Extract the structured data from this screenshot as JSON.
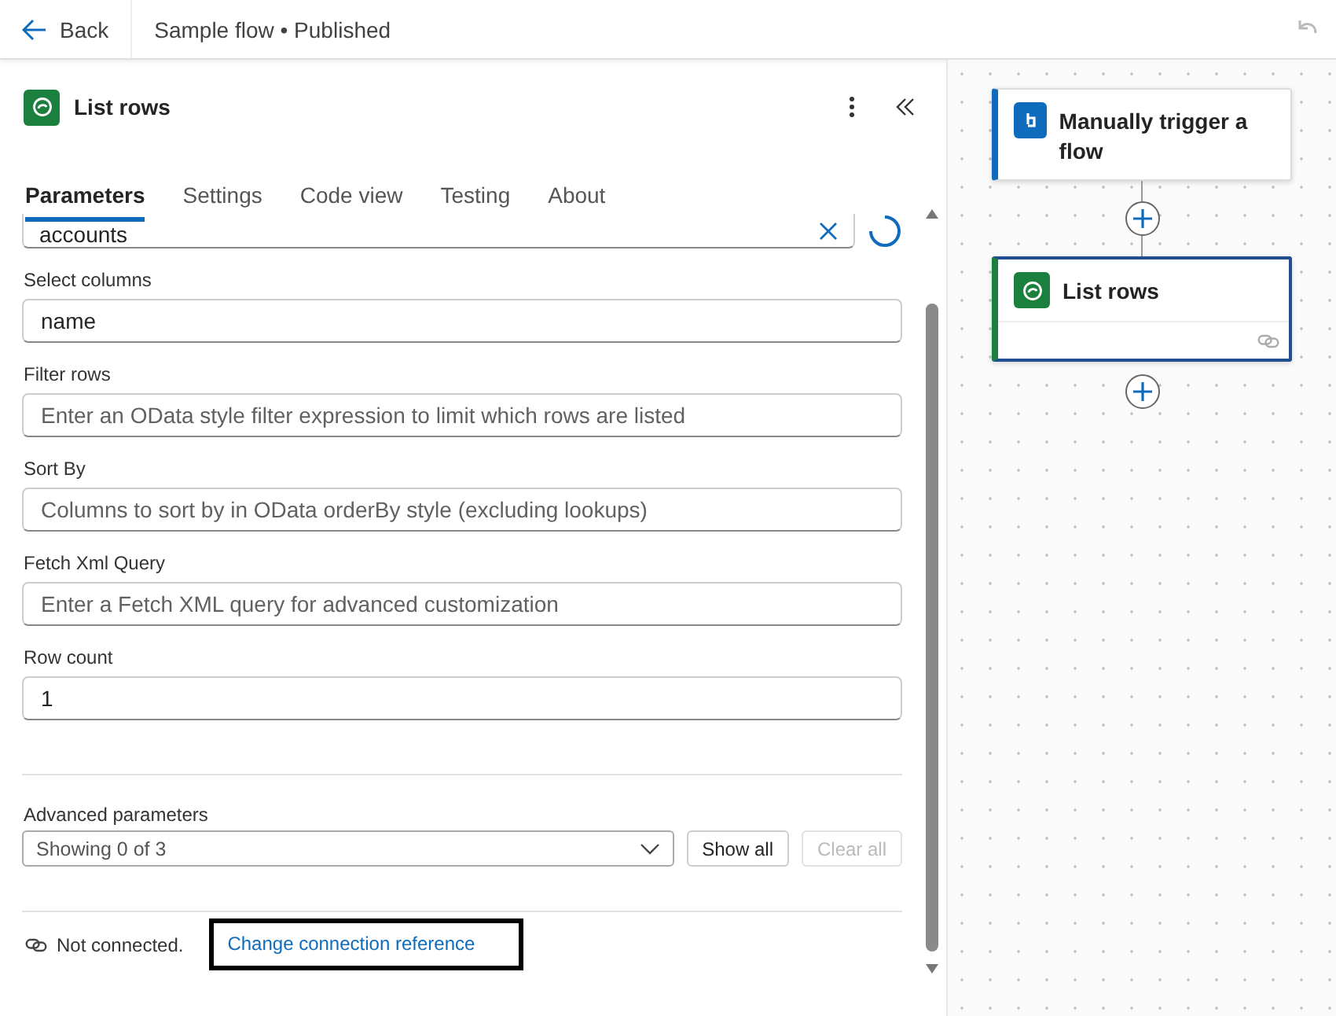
{
  "header": {
    "back": "Back",
    "title": "Sample flow • Published"
  },
  "panel": {
    "title": "List rows",
    "tabs": [
      {
        "label": "Parameters",
        "selected": true
      },
      {
        "label": "Settings",
        "selected": false
      },
      {
        "label": "Code view",
        "selected": false
      },
      {
        "label": "Testing",
        "selected": false
      },
      {
        "label": "About",
        "selected": false
      }
    ],
    "table_field": {
      "value": "accounts"
    },
    "fields": [
      {
        "label": "Select columns",
        "value": "name"
      },
      {
        "label": "Filter rows",
        "placeholder": "Enter an OData style filter expression to limit which rows are listed"
      },
      {
        "label": "Sort By",
        "placeholder": "Columns to sort by in OData orderBy style (excluding lookups)"
      },
      {
        "label": "Fetch Xml Query",
        "placeholder": "Enter a Fetch XML query for advanced customization"
      },
      {
        "label": "Row count",
        "value": "1"
      }
    ],
    "advanced": {
      "label": "Advanced parameters",
      "value": "Showing 0 of 3",
      "buttons": [
        {
          "label": "Show all",
          "disabled": false
        },
        {
          "label": "Clear all",
          "disabled": true
        }
      ]
    },
    "connection": {
      "status": "Not connected.",
      "link": "Change connection reference",
      "highlighted": true
    }
  },
  "canvas": {
    "nodes": [
      {
        "kind": "trigger",
        "title": "Manually trigger a flow",
        "selected": false
      },
      {
        "kind": "action",
        "title": "List rows",
        "selected": true
      }
    ]
  }
}
